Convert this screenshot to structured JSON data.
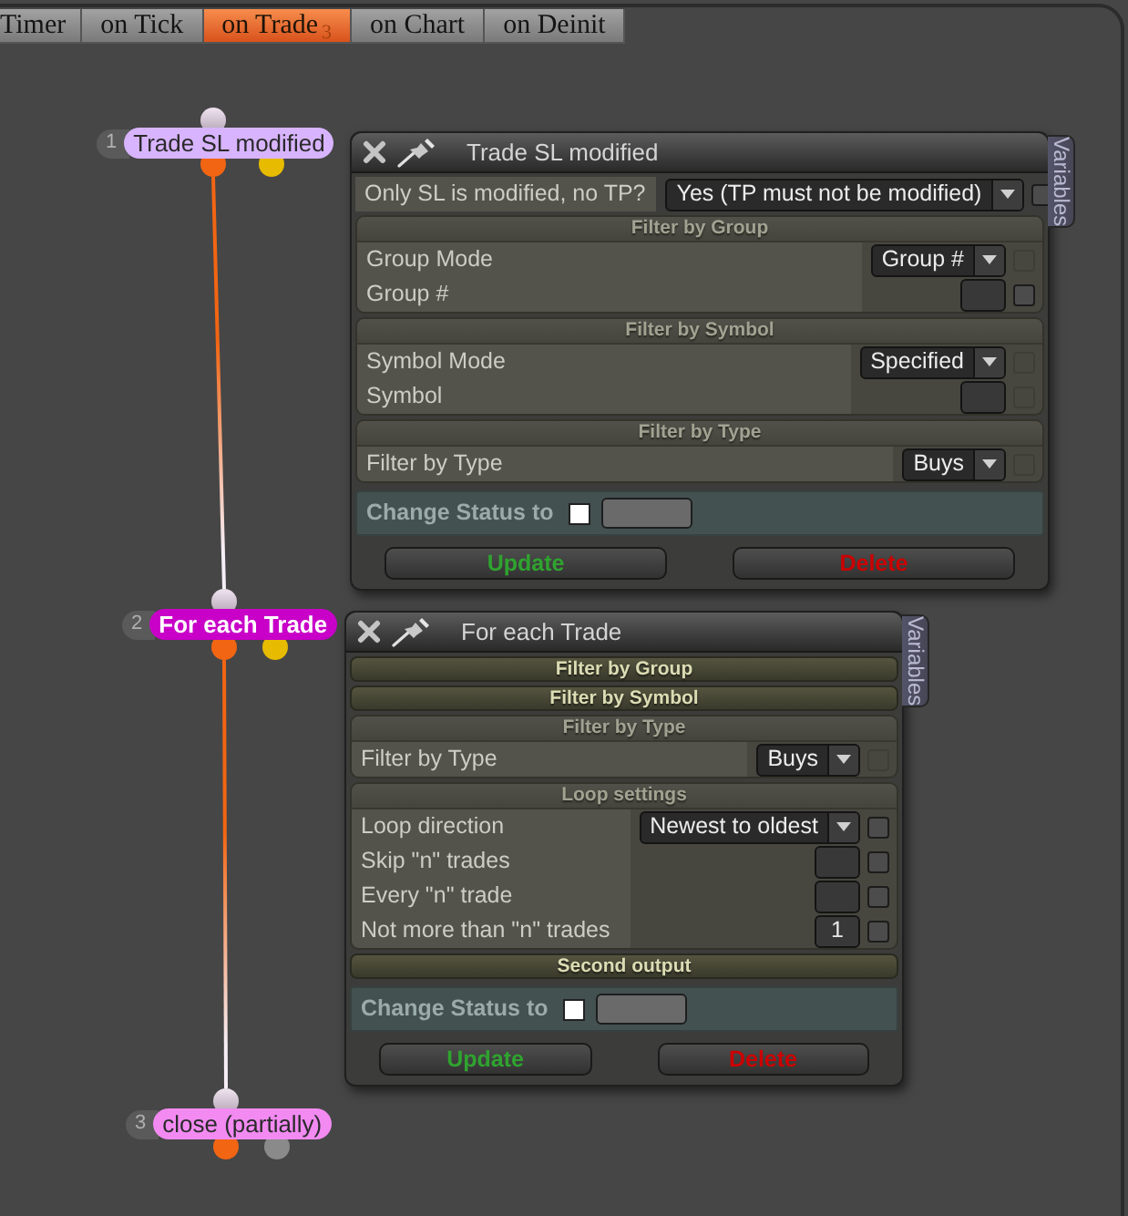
{
  "tabs": [
    {
      "label": "Timer",
      "selected": false
    },
    {
      "label": "on Tick",
      "selected": false
    },
    {
      "label": "on Trade",
      "badge": "3",
      "selected": true
    },
    {
      "label": "on Chart",
      "selected": false
    },
    {
      "label": "on Deinit",
      "selected": false
    }
  ],
  "nodes": [
    {
      "number": "1",
      "label": "Trade SL modified",
      "color": "#d8b4fe",
      "selected": false,
      "outputs": [
        {
          "color": "#f26513",
          "connected": true
        },
        {
          "color": "#e6bb00",
          "connected": false
        }
      ]
    },
    {
      "number": "2",
      "label": "For each Trade",
      "color": "#c800c8",
      "selected": true,
      "outputs": [
        {
          "color": "#f26513",
          "connected": true
        },
        {
          "color": "#e6bb00",
          "connected": false
        }
      ]
    },
    {
      "number": "3",
      "label": "close (partially)",
      "color": "#f28af2",
      "selected": false,
      "outputs": [
        {
          "color": "#f26513",
          "connected": false
        },
        {
          "color": "#8a8a8a",
          "connected": false
        }
      ]
    }
  ],
  "panels": [
    {
      "title": "Trade SL modified",
      "side_tab": "Variables",
      "items": [
        {
          "kind": "field",
          "label": "Only SL is modified, no TP?",
          "control": {
            "kind": "dropdown",
            "value": "Yes (TP must not be modified)"
          },
          "checkbox": {
            "checked": false,
            "disabled": false
          }
        },
        {
          "kind": "section",
          "title": "Filter by Group",
          "expanded": true,
          "fields": [
            {
              "label": "Group Mode",
              "control": {
                "kind": "dropdown",
                "value": "Group #"
              },
              "checkbox": {
                "checked": false,
                "disabled": true
              }
            },
            {
              "label": "Group #",
              "control": {
                "kind": "input"
              },
              "checkbox": {
                "checked": false,
                "disabled": false
              }
            }
          ]
        },
        {
          "kind": "section",
          "title": "Filter by Symbol",
          "expanded": true,
          "fields": [
            {
              "label": "Symbol Mode",
              "control": {
                "kind": "dropdown",
                "value": "Specified"
              },
              "checkbox": {
                "checked": false,
                "disabled": true
              }
            },
            {
              "label": "Symbol",
              "control": {
                "kind": "input"
              },
              "checkbox": {
                "checked": false,
                "disabled": true
              }
            }
          ]
        },
        {
          "kind": "section",
          "title": "Filter by Type",
          "expanded": true,
          "fields": [
            {
              "label": "Filter by Type",
              "control": {
                "kind": "dropdown",
                "value": "Buys"
              },
              "checkbox": {
                "checked": false,
                "disabled": true
              }
            }
          ]
        }
      ],
      "status": {
        "label": "Change Status to",
        "checked": false
      },
      "buttons": [
        {
          "kind": "update",
          "label": "Update"
        },
        {
          "kind": "delete",
          "label": "Delete"
        }
      ]
    },
    {
      "title": "For each Trade",
      "side_tab": "Variables",
      "items": [
        {
          "kind": "section",
          "title": "Filter by Group",
          "expanded": false
        },
        {
          "kind": "section",
          "title": "Filter by Symbol",
          "expanded": false
        },
        {
          "kind": "section",
          "title": "Filter by Type",
          "expanded": true,
          "fields": [
            {
              "label": "Filter by Type",
              "control": {
                "kind": "dropdown",
                "value": "Buys"
              },
              "checkbox": {
                "checked": false,
                "disabled": true
              }
            }
          ]
        },
        {
          "kind": "section",
          "title": "Loop settings",
          "expanded": true,
          "fields": [
            {
              "label": "Loop direction",
              "control": {
                "kind": "dropdown",
                "value": "Newest to oldest"
              },
              "checkbox": {
                "checked": false,
                "disabled": false
              }
            },
            {
              "label": "Skip \"n\" trades",
              "control": {
                "kind": "input"
              },
              "checkbox": {
                "checked": false,
                "disabled": false
              }
            },
            {
              "label": "Every \"n\" trade",
              "control": {
                "kind": "input"
              },
              "checkbox": {
                "checked": false,
                "disabled": false
              }
            },
            {
              "label": "Not more than \"n\" trades",
              "control": {
                "kind": "input",
                "value": "1"
              },
              "checkbox": {
                "checked": false,
                "disabled": false
              }
            }
          ]
        },
        {
          "kind": "section",
          "title": "Second output",
          "expanded": false
        }
      ],
      "status": {
        "label": "Change Status to",
        "checked": false
      },
      "buttons": [
        {
          "kind": "update",
          "label": "Update"
        },
        {
          "kind": "delete",
          "label": "Delete"
        }
      ]
    }
  ]
}
